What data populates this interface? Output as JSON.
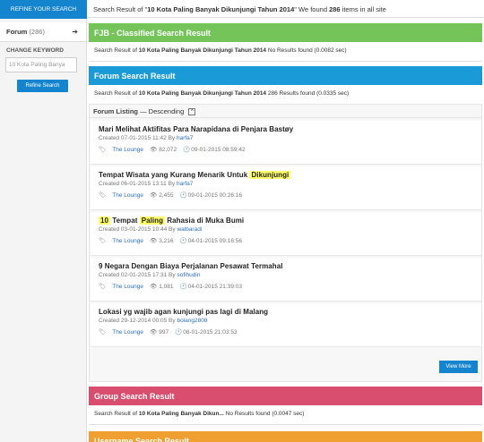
{
  "sidebar": {
    "refine_label": "REFINE YOUR SEARCH",
    "forum_label": "Forum",
    "forum_count": "(286)",
    "change_keyword_label": "CHANGE KEYWORD",
    "keyword_value": "10 Kota Paling Banya",
    "refine_button": "Refine Search"
  },
  "summary": {
    "prefix": "Search Result of \"",
    "query": "10 Kota Paling Banyak Dikunjungi Tahun 2014",
    "mid": "\" We found ",
    "total": "286",
    "suffix": " items in all site"
  },
  "fjb": {
    "title": "FJB - Classified Search Result",
    "prefix": "Search Result of ",
    "query": "10 Kota Paling Banyak Dikunjungi Tahun 2014",
    "status": "  No Results found (0.0082 sec)",
    "color": "#74c45a"
  },
  "forum": {
    "title": "Forum Search Result",
    "prefix": "Search Result of ",
    "query": "10 Kota Paling Banyak Dikunjungi Tahun 2014",
    "status": " 286 Results found (0.0335 sec)",
    "color": "#1a9ad6",
    "listing_label": "Forum Listing",
    "listing_order": " — Descending",
    "view_more": "View More",
    "threads": [
      {
        "title_a": "Mari Melihat Aktifitas Para Narapidana di Penjara Bastøy",
        "hl1": "",
        "title_b": "",
        "hl2": "",
        "title_c": "",
        "created": "Created 07-01-2015 11:42 By ",
        "author": "harfa7",
        "category": "The Lounge",
        "views": "82,072",
        "last": "09-01-2015 08:59:42"
      },
      {
        "title_a": "Tempat Wisata yang Kurang Menarik Untuk ",
        "hl1": "Dikunjungi",
        "title_b": "",
        "hl2": "",
        "title_c": "",
        "created": "Created 06-01-2015 13:11 By ",
        "author": "harfa7",
        "category": "The Lounge",
        "views": "2,455",
        "last": "09-01-2015 00:26:16"
      },
      {
        "title_a": "",
        "hl1": "10",
        "title_b": " Tempat ",
        "hl2": "Paling",
        "title_c": " Rahasia di Muka Bumi",
        "created": "Created 03-01-2015 10:44 By ",
        "author": "walbaradi",
        "category": "The Lounge",
        "views": "3,216",
        "last": "04-01-2015 09:16:56"
      },
      {
        "title_a": "9 Negara Dengan Biaya Perjalanan Pesawat Termahal",
        "hl1": "",
        "title_b": "",
        "hl2": "",
        "title_c": "",
        "created": "Created 02-01-2015 17:31 By ",
        "author": "sofihudin",
        "category": "The Lounge",
        "views": "1,081",
        "last": "04-01-2015 21:39:03"
      },
      {
        "title_a": "Lokasi yg wajib agan kunjungi pas lagi di Malang",
        "hl1": "",
        "title_b": "",
        "hl2": "",
        "title_c": "",
        "created": "Created 29-12-2014 00:05 By ",
        "author": "bolang2808",
        "category": "The Lounge",
        "views": "997",
        "last": "08-01-2015 21:03:53"
      }
    ]
  },
  "group": {
    "title": "Group Search Result",
    "prefix": "Search Result of ",
    "query": "10 Kota Paling Banyak Dikun...",
    "status": " No Results found (0.0047 sec)",
    "color": "#d94d6e"
  },
  "username": {
    "title": "Username Search Result",
    "color": "#f0a030"
  },
  "icons": {
    "tag": "tag-icon",
    "eye": "eye-icon",
    "clock": "clock-icon",
    "arrow": "arrow-right-icon"
  }
}
